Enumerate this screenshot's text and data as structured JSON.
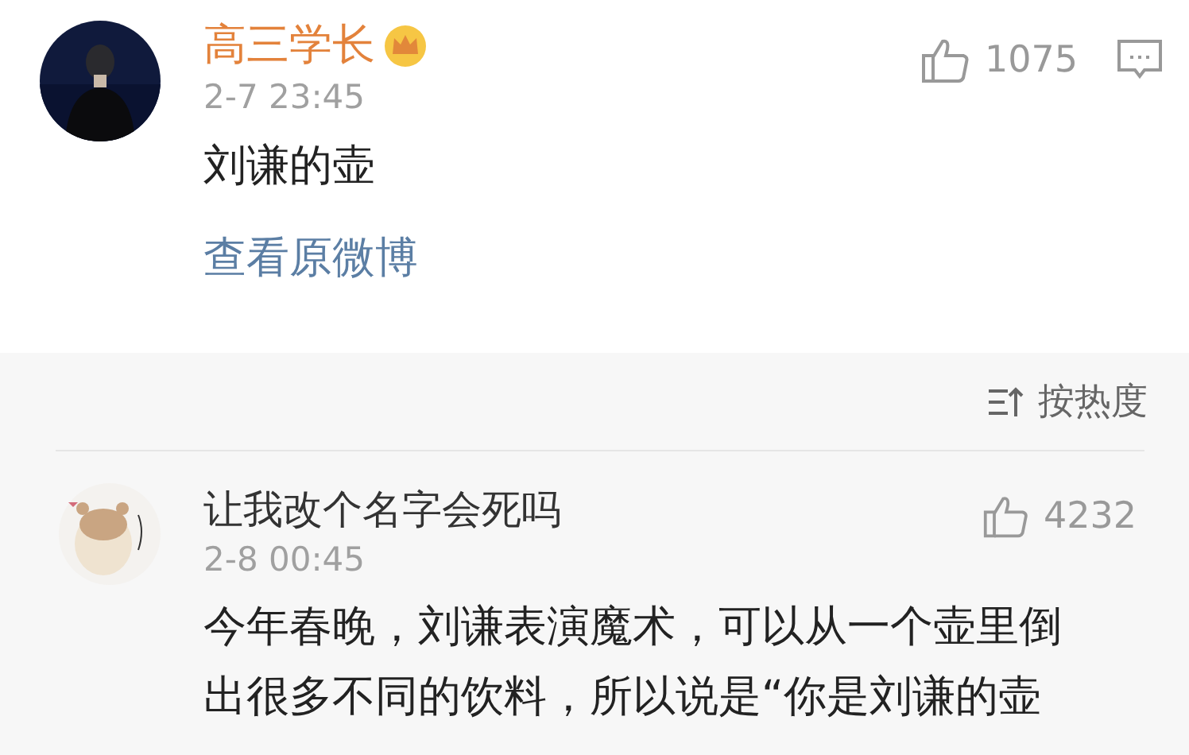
{
  "post": {
    "author": "高三学长",
    "time": "2-7 23:45",
    "likes": "1075",
    "text": "刘谦的壶",
    "link": "查看原微博"
  },
  "sort": {
    "label": "按热度"
  },
  "comments": [
    {
      "author": "让我改个名字会死吗",
      "time": "2-8 00:45",
      "likes": "4232",
      "text": "今年春晚，刘谦表演魔术，可以从一个壶里倒出很多不同的饮料，所以说是“你是刘谦的壶"
    }
  ]
}
